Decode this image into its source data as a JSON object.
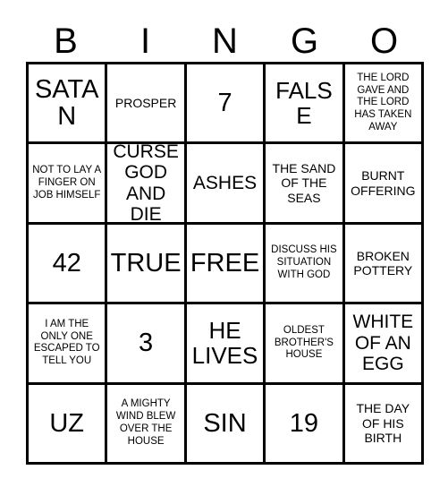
{
  "header": {
    "letters": [
      "B",
      "I",
      "N",
      "G",
      "O"
    ]
  },
  "grid": {
    "rows": [
      [
        {
          "text": "SATAN",
          "size": "xl"
        },
        {
          "text": "PROSPER",
          "size": "sm"
        },
        {
          "text": "7",
          "size": "xl"
        },
        {
          "text": "FALSE",
          "size": "lg"
        },
        {
          "text": "THE LORD GAVE AND THE LORD HAS TAKEN AWAY",
          "size": "xs"
        }
      ],
      [
        {
          "text": "NOT TO LAY A FINGER ON JOB HIMSELF",
          "size": "xs"
        },
        {
          "text": "CURSE GOD AND DIE",
          "size": "md"
        },
        {
          "text": "ASHES",
          "size": "md"
        },
        {
          "text": "THE SAND OF THE SEAS",
          "size": "sm"
        },
        {
          "text": "BURNT OFFERING",
          "size": "sm"
        }
      ],
      [
        {
          "text": "42",
          "size": "xl"
        },
        {
          "text": "TRUE",
          "size": "xl"
        },
        {
          "text": "FREE",
          "size": "xl"
        },
        {
          "text": "DISCUSS HIS SITUATION WITH GOD",
          "size": "xs"
        },
        {
          "text": "BROKEN POTTERY",
          "size": "sm"
        }
      ],
      [
        {
          "text": "I AM THE ONLY ONE ESCAPED TO TELL YOU",
          "size": "xs"
        },
        {
          "text": "3",
          "size": "xl"
        },
        {
          "text": "HE LIVES",
          "size": "lg"
        },
        {
          "text": "OLDEST BROTHER'S HOUSE",
          "size": "xs"
        },
        {
          "text": "WHITE OF AN EGG",
          "size": "md"
        }
      ],
      [
        {
          "text": "UZ",
          "size": "xl"
        },
        {
          "text": "A MIGHTY WIND BLEW OVER THE HOUSE",
          "size": "xs"
        },
        {
          "text": "SIN",
          "size": "xl"
        },
        {
          "text": "19",
          "size": "xl"
        },
        {
          "text": "THE DAY OF HIS BIRTH",
          "size": "sm"
        }
      ]
    ]
  }
}
